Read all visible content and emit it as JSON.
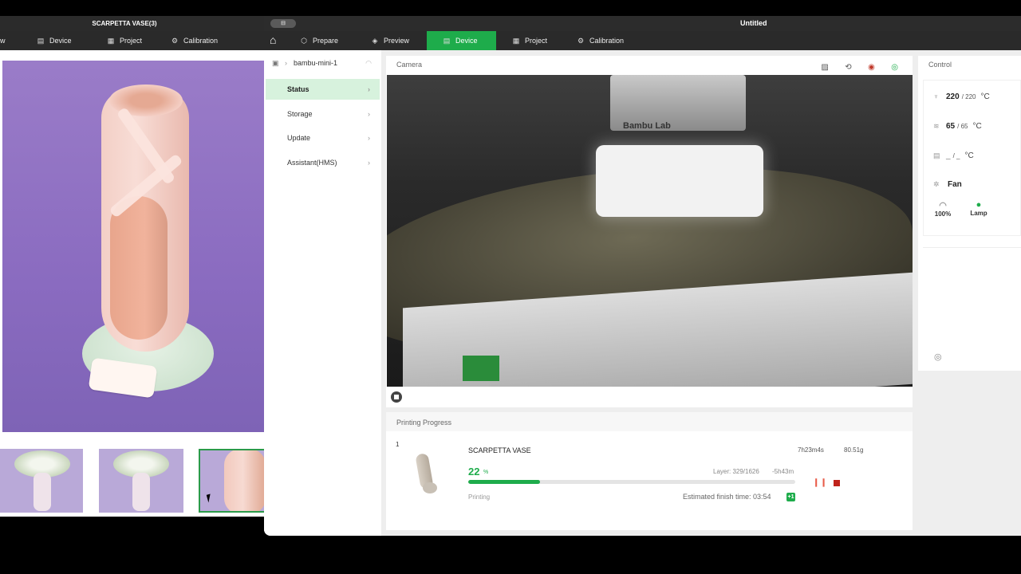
{
  "left_window": {
    "title": "SCARPETTA VASE(3)",
    "tabs": [
      "w",
      "Device",
      "Project",
      "Calibration"
    ]
  },
  "main_window": {
    "title": "Untitled",
    "tabs": [
      "Prepare",
      "Preview",
      "Device",
      "Project",
      "Calibration"
    ],
    "active_tab": "Device"
  },
  "sidebar": {
    "device_name": "bambu-mini-1",
    "items": [
      "Status",
      "Storage",
      "Update",
      "Assistant(HMS)"
    ],
    "active_item": "Status"
  },
  "camera": {
    "label": "Camera",
    "video_overlay_text": "Bambu Lab"
  },
  "control": {
    "label": "Control",
    "nozzle_temp": "220",
    "nozzle_target": "/ 220",
    "bed_temp": "65",
    "bed_target": "/ 65",
    "chamber_temp": "_",
    "chamber_target": "/ _",
    "unit": "°C",
    "fan_label": "Fan",
    "speed_label": "100%",
    "lamp_label": "Lamp"
  },
  "progress": {
    "label": "Printing Progress",
    "plate_no": "1",
    "job_name": "SCARPETTA VASE",
    "total_time": "7h23m4s",
    "weight": "80.51g",
    "percent": "22",
    "percent_symbol": "%",
    "percent_value": 22,
    "layer": "Layer: 329/1626",
    "remaining": "-5h43m",
    "status": "Printing",
    "finish_time": "Estimated finish time: 03:54",
    "finish_badge": "+1"
  },
  "colors": {
    "accent": "#1eac4b",
    "stop": "#c0231b",
    "pause": "#e85c4a"
  }
}
